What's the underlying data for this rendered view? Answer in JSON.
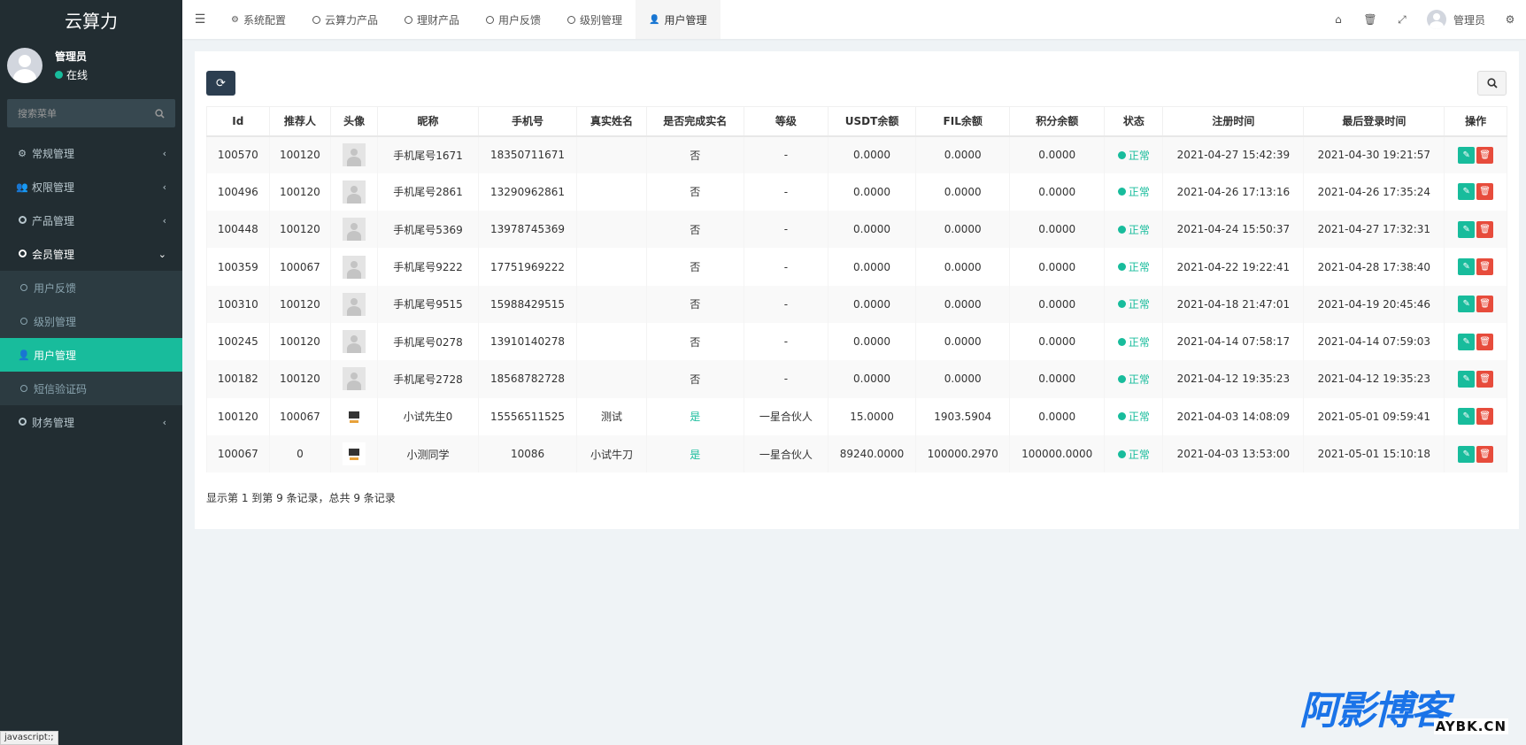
{
  "app": {
    "logo": "云算力"
  },
  "sidebar": {
    "user_name": "管理员",
    "user_status": "在线",
    "search_placeholder": "搜索菜单",
    "items": [
      {
        "label": "常规管理",
        "icon": "cogs-icon"
      },
      {
        "label": "权限管理",
        "icon": "group-icon"
      },
      {
        "label": "产品管理",
        "icon": "circle-icon"
      },
      {
        "label": "会员管理",
        "icon": "circle-icon"
      },
      {
        "label": "财务管理",
        "icon": "circle-icon"
      }
    ],
    "submenu": [
      {
        "label": "用户反馈"
      },
      {
        "label": "级别管理"
      },
      {
        "label": "用户管理"
      },
      {
        "label": "短信验证码"
      }
    ]
  },
  "topbar": {
    "tabs": [
      {
        "label": "系统配置"
      },
      {
        "label": "云算力产品"
      },
      {
        "label": "理财产品"
      },
      {
        "label": "用户反馈"
      },
      {
        "label": "级别管理"
      },
      {
        "label": "用户管理"
      }
    ],
    "user_name": "管理员"
  },
  "table": {
    "headers": [
      "Id",
      "推荐人",
      "头像",
      "昵称",
      "手机号",
      "真实姓名",
      "是否完成实名",
      "等级",
      "USDT余额",
      "FIL余额",
      "积分余额",
      "状态",
      "注册时间",
      "最后登录时间",
      "操作"
    ],
    "rows": [
      {
        "id": "100570",
        "ref": "100120",
        "avatar": "default",
        "nick": "手机尾号1671",
        "phone": "18350711671",
        "real": "",
        "verified": "否",
        "level": "-",
        "usdt": "0.0000",
        "fil": "0.0000",
        "points": "0.0000",
        "status": "正常",
        "reg": "2021-04-27 15:42:39",
        "last": "2021-04-30 19:21:57"
      },
      {
        "id": "100496",
        "ref": "100120",
        "avatar": "default",
        "nick": "手机尾号2861",
        "phone": "13290962861",
        "real": "",
        "verified": "否",
        "level": "-",
        "usdt": "0.0000",
        "fil": "0.0000",
        "points": "0.0000",
        "status": "正常",
        "reg": "2021-04-26 17:13:16",
        "last": "2021-04-26 17:35:24"
      },
      {
        "id": "100448",
        "ref": "100120",
        "avatar": "default",
        "nick": "手机尾号5369",
        "phone": "13978745369",
        "real": "",
        "verified": "否",
        "level": "-",
        "usdt": "0.0000",
        "fil": "0.0000",
        "points": "0.0000",
        "status": "正常",
        "reg": "2021-04-24 15:50:37",
        "last": "2021-04-27 17:32:31"
      },
      {
        "id": "100359",
        "ref": "100067",
        "avatar": "default",
        "nick": "手机尾号9222",
        "phone": "17751969222",
        "real": "",
        "verified": "否",
        "level": "-",
        "usdt": "0.0000",
        "fil": "0.0000",
        "points": "0.0000",
        "status": "正常",
        "reg": "2021-04-22 19:22:41",
        "last": "2021-04-28 17:38:40"
      },
      {
        "id": "100310",
        "ref": "100120",
        "avatar": "default",
        "nick": "手机尾号9515",
        "phone": "15988429515",
        "real": "",
        "verified": "否",
        "level": "-",
        "usdt": "0.0000",
        "fil": "0.0000",
        "points": "0.0000",
        "status": "正常",
        "reg": "2021-04-18 21:47:01",
        "last": "2021-04-19 20:45:46"
      },
      {
        "id": "100245",
        "ref": "100120",
        "avatar": "default",
        "nick": "手机尾号0278",
        "phone": "13910140278",
        "real": "",
        "verified": "否",
        "level": "-",
        "usdt": "0.0000",
        "fil": "0.0000",
        "points": "0.0000",
        "status": "正常",
        "reg": "2021-04-14 07:58:17",
        "last": "2021-04-14 07:59:03"
      },
      {
        "id": "100182",
        "ref": "100120",
        "avatar": "default",
        "nick": "手机尾号2728",
        "phone": "18568782728",
        "real": "",
        "verified": "否",
        "level": "-",
        "usdt": "0.0000",
        "fil": "0.0000",
        "points": "0.0000",
        "status": "正常",
        "reg": "2021-04-12 19:35:23",
        "last": "2021-04-12 19:35:23"
      },
      {
        "id": "100120",
        "ref": "100067",
        "avatar": "custom",
        "nick": "小试先生0",
        "phone": "15556511525",
        "real": "测试",
        "verified": "是",
        "level": "一星合伙人",
        "usdt": "15.0000",
        "fil": "1903.5904",
        "points": "0.0000",
        "status": "正常",
        "reg": "2021-04-03 14:08:09",
        "last": "2021-05-01 09:59:41"
      },
      {
        "id": "100067",
        "ref": "0",
        "avatar": "custom",
        "nick": "小测同学",
        "phone": "10086",
        "real": "小试牛刀",
        "verified": "是",
        "level": "一星合伙人",
        "usdt": "89240.0000",
        "fil": "100000.2970",
        "points": "100000.0000",
        "status": "正常",
        "reg": "2021-04-03 13:53:00",
        "last": "2021-05-01 15:10:18"
      }
    ]
  },
  "pager": {
    "summary": "显示第 1 到第 9 条记录，总共 9 条记录"
  },
  "statusbar": {
    "text": "javascript:;"
  },
  "watermark": {
    "big": "阿影博客",
    "small": "AYBK.CN"
  },
  "colors": {
    "sidebar": "#222d32",
    "accent": "#18bc9c",
    "danger": "#e74c3c",
    "toolbar": "#2c3e50"
  }
}
